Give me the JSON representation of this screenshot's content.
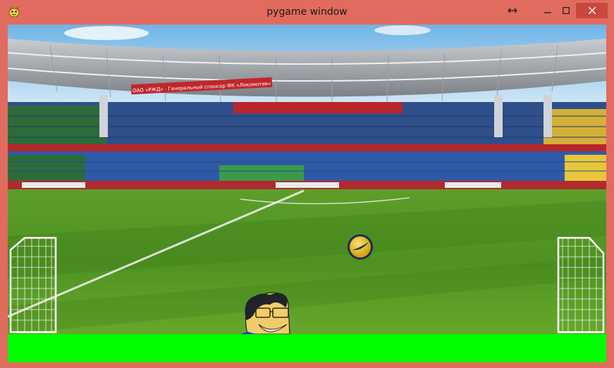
{
  "window": {
    "title": "pygame window",
    "icons": {
      "app": "pygame-snake-icon",
      "resize": "resize-arrows-icon",
      "minimize": "minimize-icon",
      "maximize": "maximize-icon",
      "close": "close-icon"
    },
    "border_color": "#e26b60",
    "close_color": "#c9483e"
  },
  "game": {
    "background": "football-stadium",
    "ground_color": "#00ff00",
    "goal_color": "#ffffff",
    "ball_color": "#f2c200",
    "stadium": {
      "banner_left": "ОАО «РЖД» · Генеральный спонсор ФК «Локомотив»"
    }
  }
}
